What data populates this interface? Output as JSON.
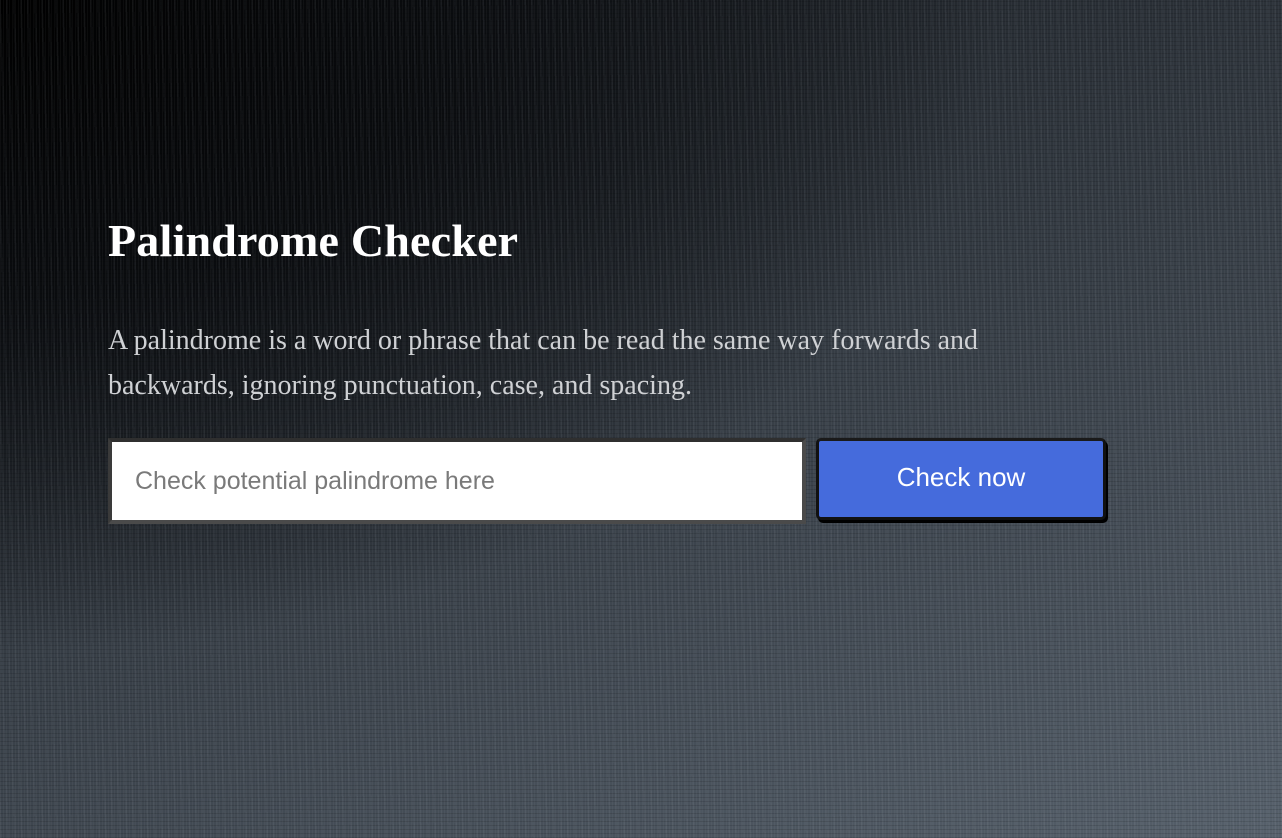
{
  "page": {
    "title": "Palindrome Checker",
    "description": "A palindrome is a word or phrase that can be read the same way forwards and backwards, ignoring punctuation, case, and spacing."
  },
  "form": {
    "input_value": "",
    "input_placeholder": "Check potential palindrome here",
    "button_label": "Check now"
  },
  "colors": {
    "button_bg": "#456bdc",
    "title_text": "#ffffff",
    "description_text": "#cfd1d4"
  }
}
